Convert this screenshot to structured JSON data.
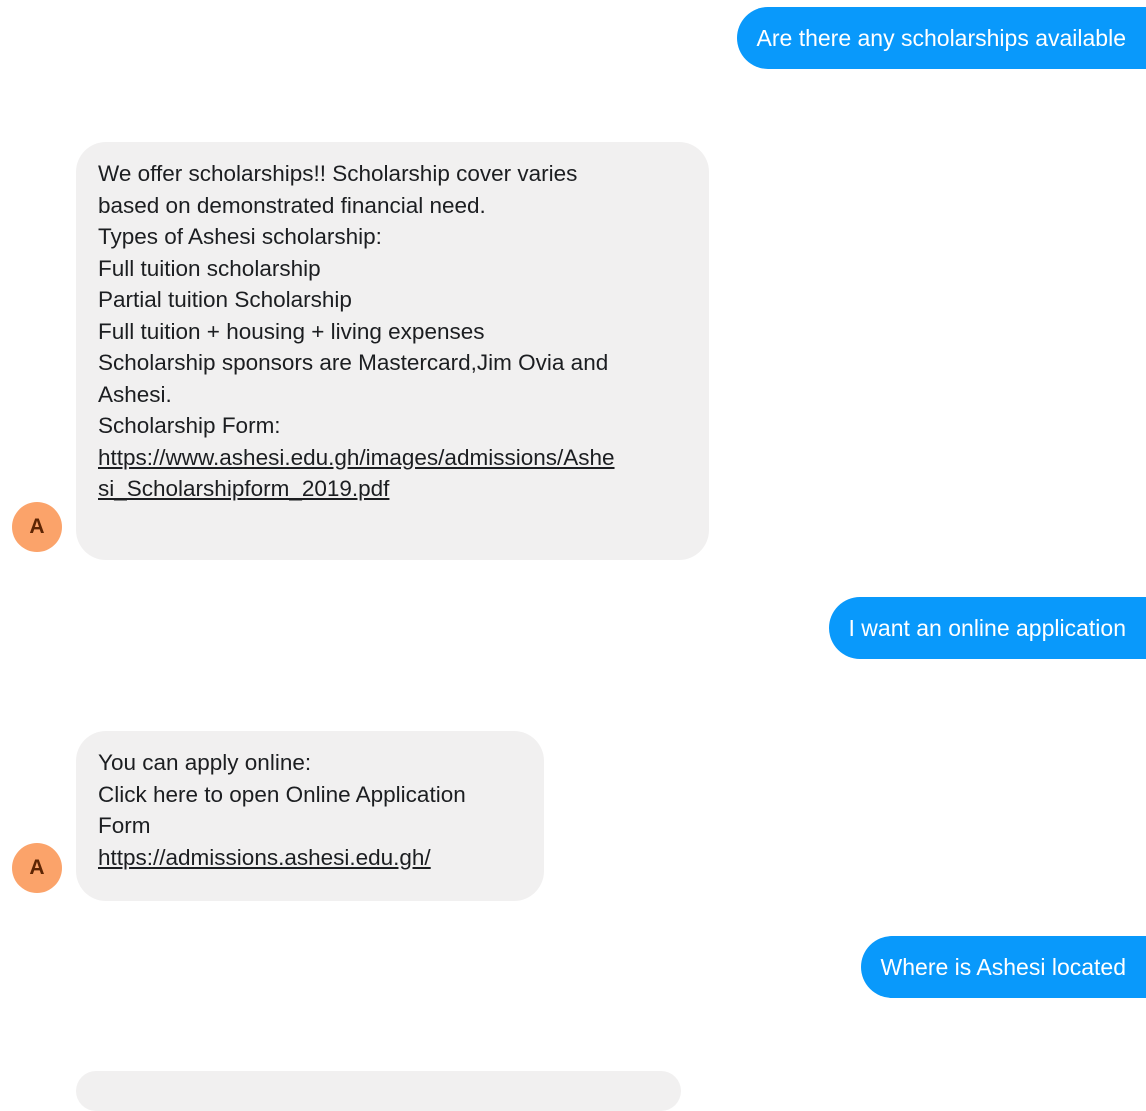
{
  "bot": {
    "avatar_letter": "A"
  },
  "messages": {
    "m1": {
      "text": "Are there any scholarships available"
    },
    "m2": {
      "lines": [
        "We offer scholarships!! Scholarship cover varies",
        "based on demonstrated financial need.",
        "Types of Ashesi scholarship:",
        "Full tuition scholarship",
        "Partial tuition Scholarship",
        "Full tuition + housing + living expenses",
        "Scholarship sponsors are Mastercard,Jim Ovia and",
        "Ashesi.",
        "Scholarship Form:"
      ],
      "link_lines": [
        "https://www.ashesi.edu.gh/images/admissions/Ashe",
        "si_Scholarshipform_2019.pdf"
      ]
    },
    "m3": {
      "text": "I want an online application"
    },
    "m4": {
      "lines": [
        "You can apply online:",
        "Click here to open Online Application",
        "Form"
      ],
      "link_lines": [
        "https://admissions.ashesi.edu.gh/"
      ]
    },
    "m5": {
      "text": "Where is Ashesi located"
    }
  },
  "colors": {
    "user_bubble": "#0999fb",
    "bot_bubble": "#f1f0f0",
    "avatar_bg": "#fba36a",
    "avatar_text": "#5d2504"
  }
}
